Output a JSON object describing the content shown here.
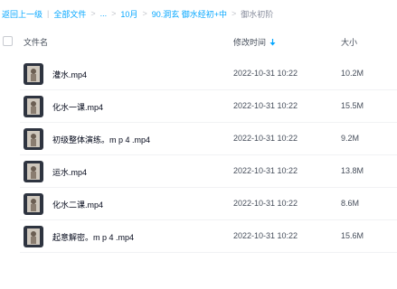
{
  "breadcrumb": {
    "back": "返回上一级",
    "sep": "|",
    "items": [
      "全部文件",
      "...",
      "10月",
      "90.洞玄 御水经初+中"
    ],
    "arrow": ">",
    "current": "御水初阶"
  },
  "table": {
    "headers": {
      "name": "文件名",
      "time": "修改时间",
      "size": "大小"
    },
    "sort_icon": "sort-down-icon",
    "rows": [
      {
        "name": "灌水.mp4",
        "time": "2022-10-31 10:22",
        "size": "10.2M"
      },
      {
        "name": "化水一课.mp4",
        "time": "2022-10-31 10:22",
        "size": "15.5M"
      },
      {
        "name": "初级整体演练。m p 4 .mp4",
        "time": "2022-10-31 10:22",
        "size": "9.2M"
      },
      {
        "name": "运水.mp4",
        "time": "2022-10-31 10:22",
        "size": "13.8M"
      },
      {
        "name": "化水二课.mp4",
        "time": "2022-10-31 10:22",
        "size": "8.6M"
      },
      {
        "name": "起意解密。m p 4 .mp4",
        "time": "2022-10-31 10:22",
        "size": "15.6M"
      }
    ]
  },
  "colors": {
    "link": "#06a7ff",
    "text": "#03081a",
    "muted": "#454d5a"
  }
}
